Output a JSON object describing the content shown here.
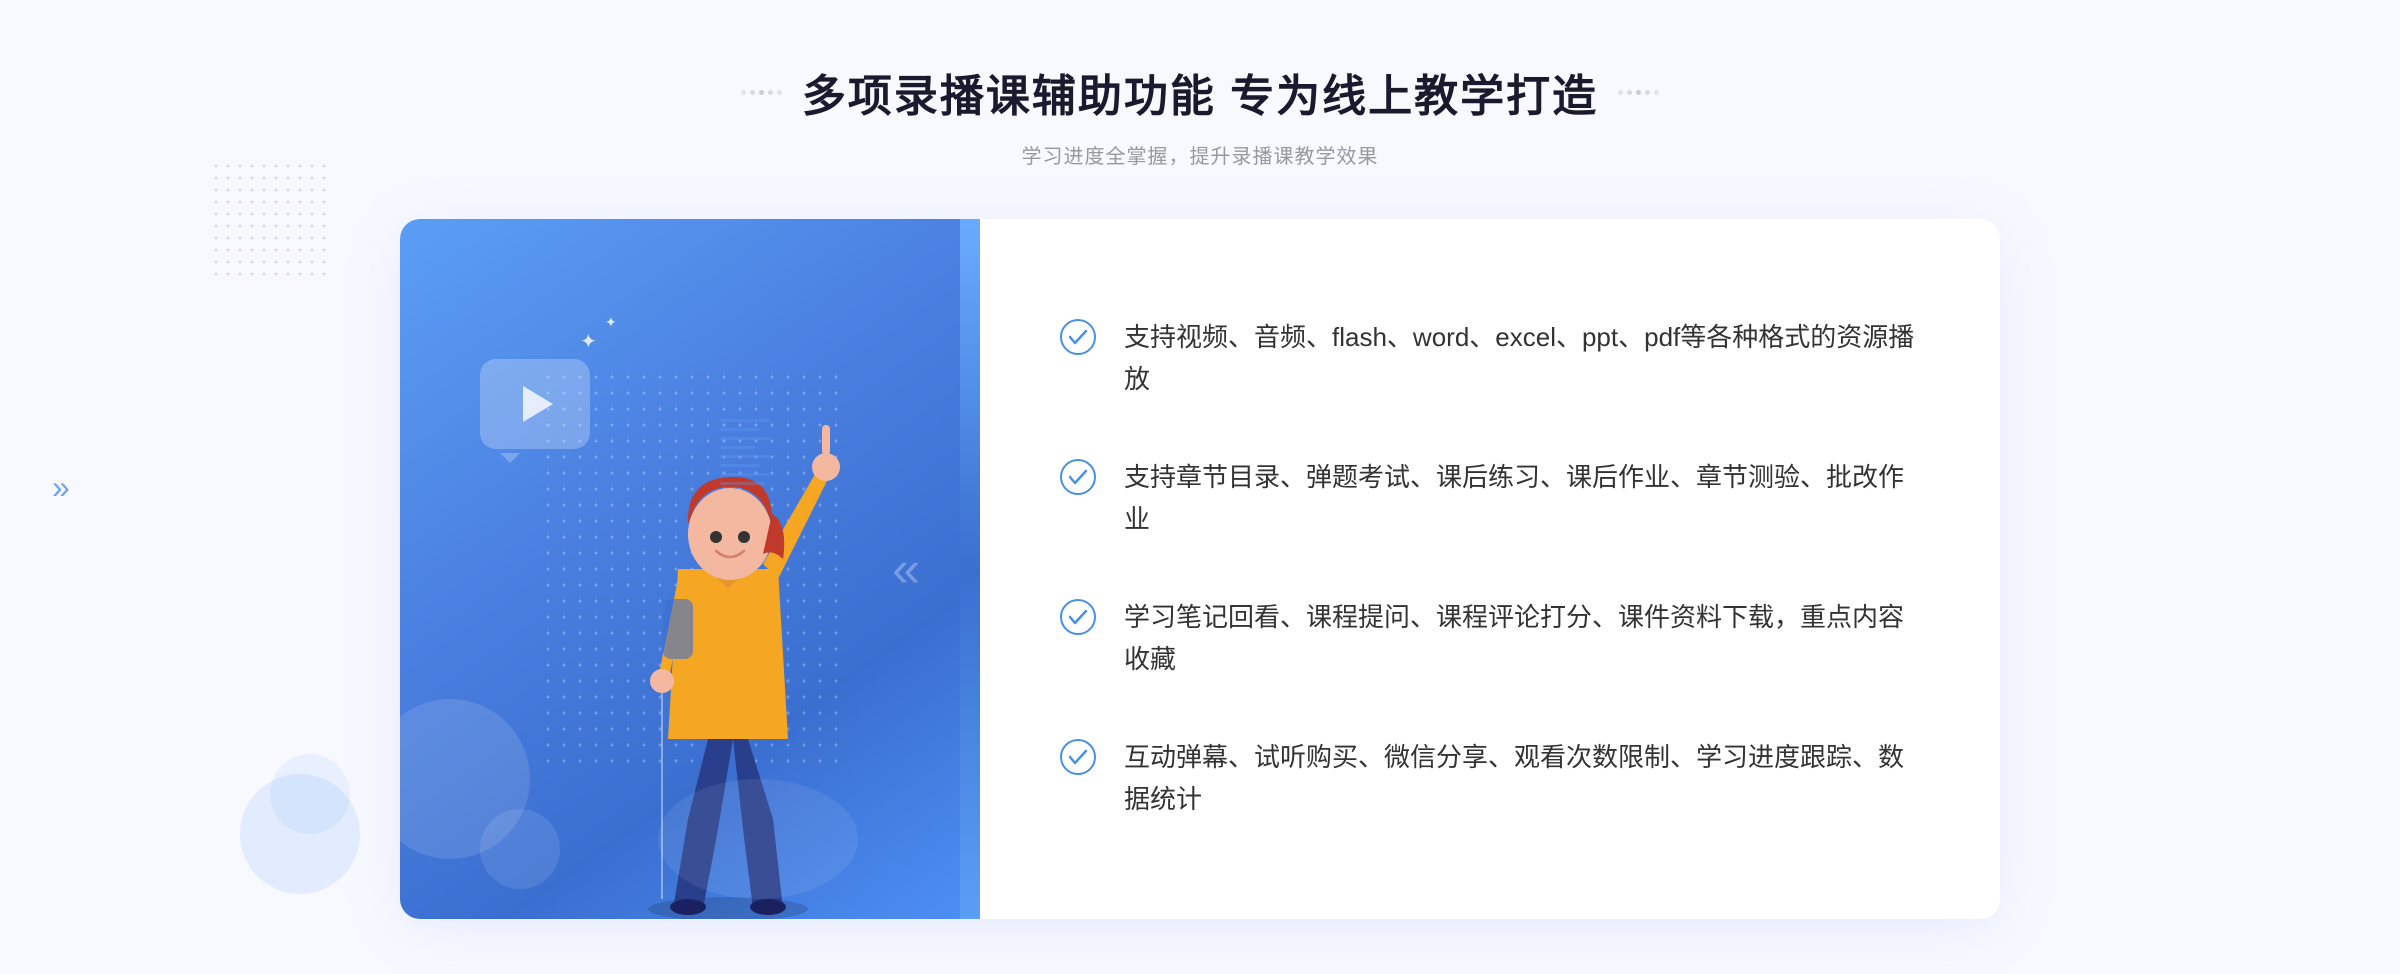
{
  "header": {
    "title": "多项录播课辅助功能 专为线上教学打造",
    "subtitle": "学习进度全掌握，提升录播课教学效果"
  },
  "features": [
    {
      "id": 1,
      "text": "支持视频、音频、flash、word、excel、ppt、pdf等各种格式的资源播放"
    },
    {
      "id": 2,
      "text": "支持章节目录、弹题考试、课后练习、课后作业、章节测验、批改作业"
    },
    {
      "id": 3,
      "text": "学习笔记回看、课程提问、课程评论打分、课件资料下载，重点内容收藏"
    },
    {
      "id": 4,
      "text": "互动弹幕、试听购买、微信分享、观看次数限制、学习进度跟踪、数据统计"
    }
  ],
  "decorators": {
    "left_arrows": "»",
    "title_dots": [
      "·",
      "·",
      "·",
      "·",
      "·"
    ]
  }
}
